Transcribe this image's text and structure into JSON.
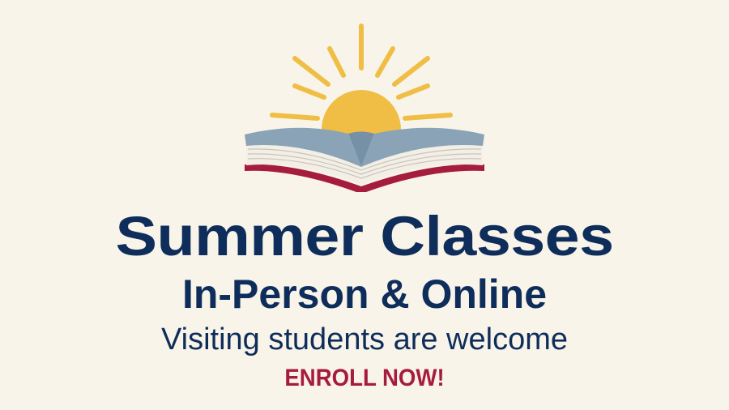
{
  "banner": {
    "headline": "Summer Classes",
    "subhead": "In-Person & Online",
    "tagline": "Visiting students are welcome",
    "cta": "ENROLL NOW!"
  },
  "icons": {
    "logo": "open-book-with-rising-sun-icon"
  },
  "colors": {
    "background": "#f8f4e9",
    "navy": "#0f2d5a",
    "crimson": "#a51c3d",
    "sun": "#f0bd45",
    "pages": "#8aa3b7"
  }
}
